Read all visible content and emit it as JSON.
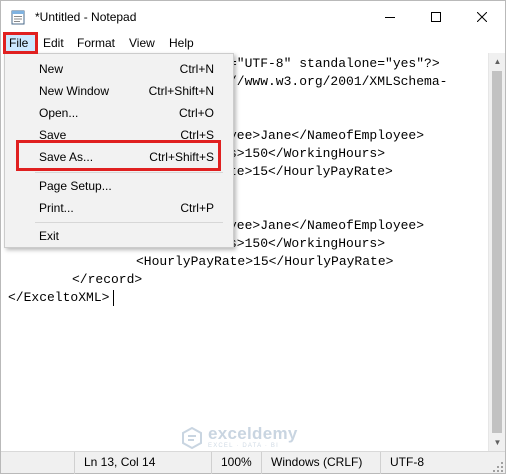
{
  "window": {
    "title": "*Untitled - Notepad",
    "controls": {
      "minimize": "–",
      "maximize": "☐",
      "close": "✕"
    }
  },
  "menubar": {
    "file": "File",
    "edit": "Edit",
    "format": "Format",
    "view": "View",
    "help": "Help"
  },
  "file_menu": {
    "items": [
      {
        "label": "New",
        "shortcut": "Ctrl+N"
      },
      {
        "label": "New Window",
        "shortcut": "Ctrl+Shift+N"
      },
      {
        "label": "Open...",
        "shortcut": "Ctrl+O"
      },
      {
        "label": "Save",
        "shortcut": "Ctrl+S"
      },
      {
        "label": "Save As...",
        "shortcut": "Ctrl+Shift+S"
      },
      {
        "label": "Page Setup...",
        "shortcut": ""
      },
      {
        "label": "Print...",
        "shortcut": "Ctrl+P"
      },
      {
        "label": "Exit",
        "shortcut": ""
      }
    ]
  },
  "editor": {
    "lines": [
      "=\"UTF-8\" standalone=\"yes\"?>",
      "//www.w3.org/2001/XMLSchema-",
      "yee>Jane</NameofEmployee>",
      "s>150</WorkingHours>",
      "te>15</HourlyPayRate>",
      "yee>Jane</NameofEmployee>",
      "s>150</WorkingHours>",
      "<HourlyPayRate>15</HourlyPayRate>",
      "</record>",
      "</ExceltoXML>"
    ]
  },
  "statusbar": {
    "position": "Ln 13, Col 14",
    "zoom": "100%",
    "line_ending": "Windows (CRLF)",
    "encoding": "UTF-8"
  },
  "watermark": {
    "name": "exceldemy",
    "tagline": "EXCEL · DATA · BI"
  },
  "colors": {
    "highlight_border": "#e02020",
    "menu_selected": "#cce8ff",
    "menu_background": "#f2f2f2",
    "statusbar_background": "#f0f0f0"
  }
}
